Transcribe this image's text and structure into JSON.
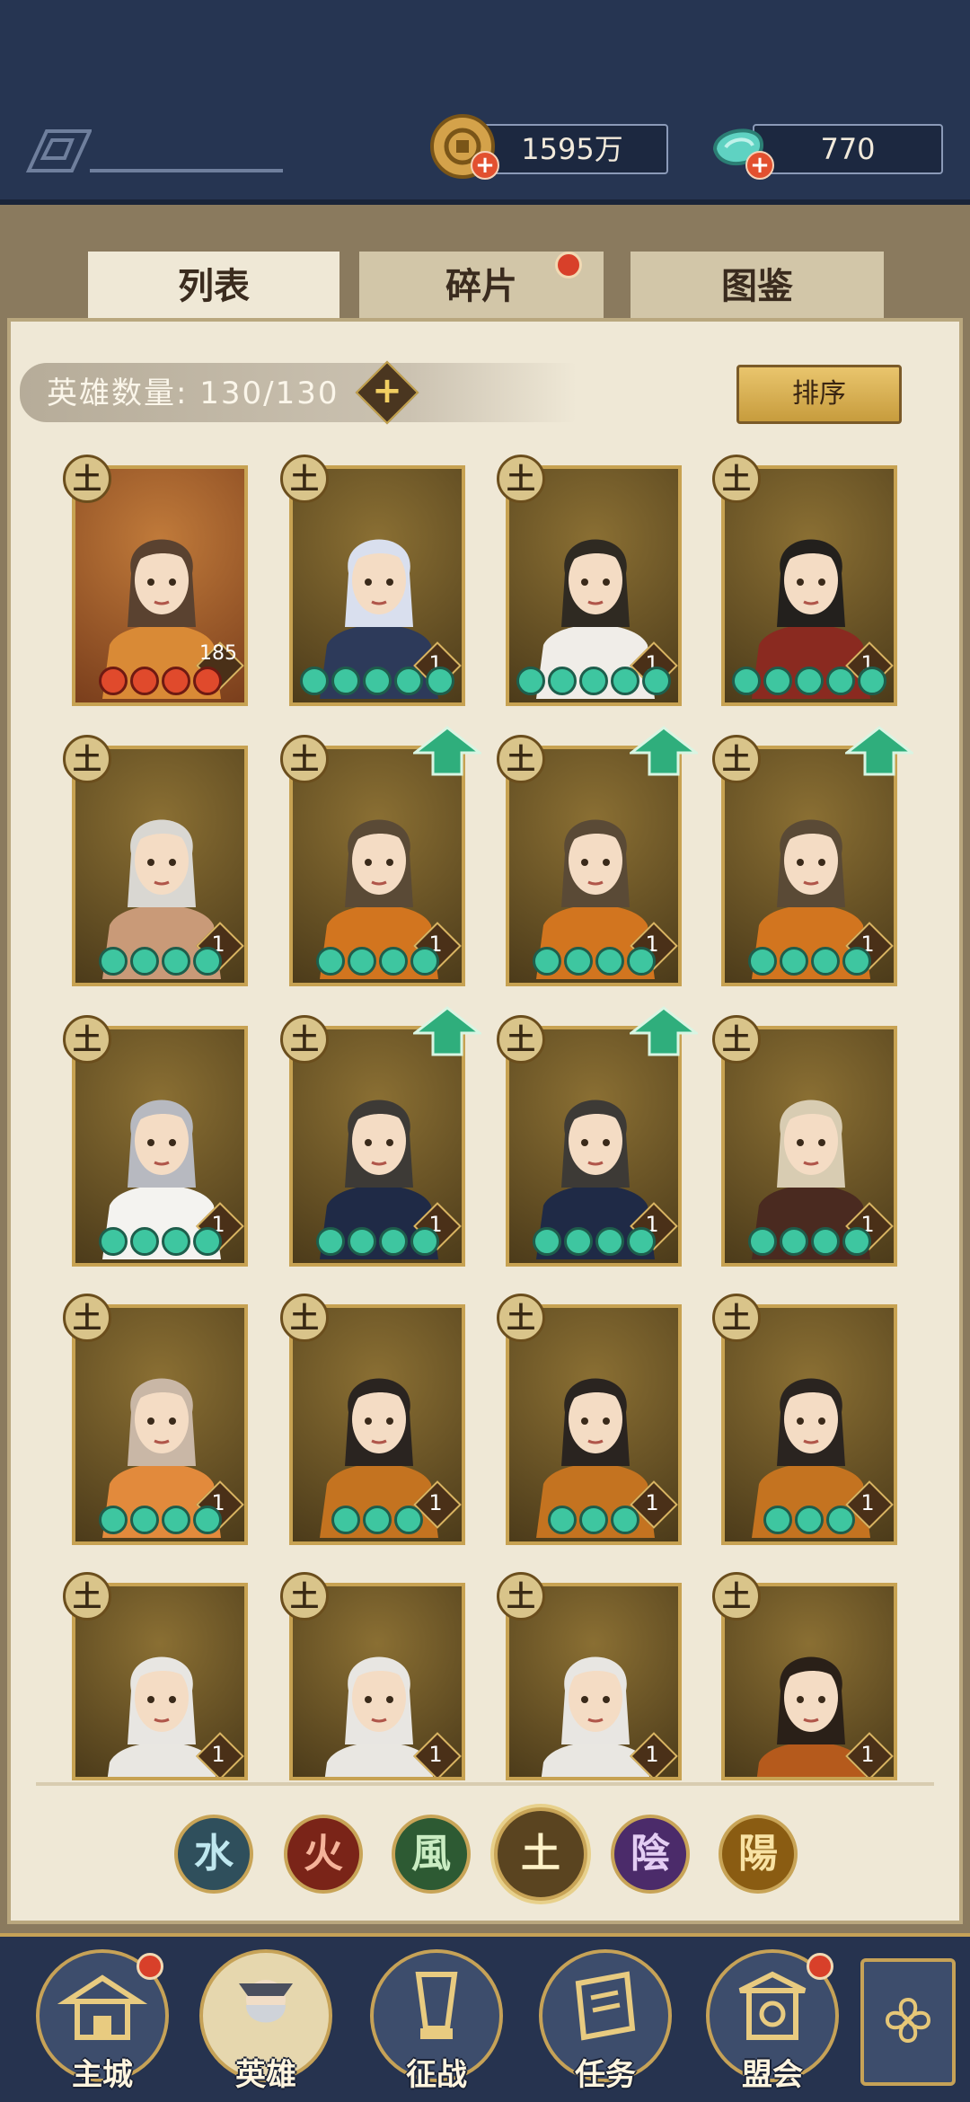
{
  "currency": {
    "coins": "1595万",
    "jade": "770"
  },
  "tabs": [
    {
      "label": "列表",
      "active": true
    },
    {
      "label": "碎片",
      "active": false,
      "badge": true
    },
    {
      "label": "图鉴",
      "active": false
    }
  ],
  "hero_count": "英雄数量: 130/130",
  "sort_label": "排序",
  "element_glyph": "土",
  "heroes": [
    {
      "level": "185",
      "orbs": 4,
      "orb_color": "red",
      "upgrade": false
    },
    {
      "level": "1",
      "orbs": 5,
      "orb_color": "green",
      "upgrade": false
    },
    {
      "level": "1",
      "orbs": 5,
      "orb_color": "green",
      "upgrade": false
    },
    {
      "level": "1",
      "orbs": 5,
      "orb_color": "green",
      "upgrade": false
    },
    {
      "level": "1",
      "orbs": 4,
      "orb_color": "green",
      "upgrade": false
    },
    {
      "level": "1",
      "orbs": 4,
      "orb_color": "green",
      "upgrade": true
    },
    {
      "level": "1",
      "orbs": 4,
      "orb_color": "green",
      "upgrade": true
    },
    {
      "level": "1",
      "orbs": 4,
      "orb_color": "green",
      "upgrade": true
    },
    {
      "level": "1",
      "orbs": 4,
      "orb_color": "green",
      "upgrade": false
    },
    {
      "level": "1",
      "orbs": 4,
      "orb_color": "green",
      "upgrade": true
    },
    {
      "level": "1",
      "orbs": 4,
      "orb_color": "green",
      "upgrade": true
    },
    {
      "level": "1",
      "orbs": 4,
      "orb_color": "green",
      "upgrade": false
    },
    {
      "level": "1",
      "orbs": 4,
      "orb_color": "green",
      "upgrade": false
    },
    {
      "level": "1",
      "orbs": 3,
      "orb_color": "green",
      "upgrade": false
    },
    {
      "level": "1",
      "orbs": 3,
      "orb_color": "green",
      "upgrade": false
    },
    {
      "level": "1",
      "orbs": 3,
      "orb_color": "green",
      "upgrade": false
    },
    {
      "level": "1",
      "orbs": 0,
      "orb_color": "green",
      "upgrade": false
    },
    {
      "level": "1",
      "orbs": 0,
      "orb_color": "green",
      "upgrade": false
    },
    {
      "level": "1",
      "orbs": 0,
      "orb_color": "green",
      "upgrade": false
    },
    {
      "level": "1",
      "orbs": 0,
      "orb_color": "green",
      "upgrade": false
    }
  ],
  "element_filters": [
    {
      "glyph": "水",
      "color": "#2f4f5c",
      "text_color": "#bfe7ef"
    },
    {
      "glyph": "火",
      "color": "#7a2418",
      "text_color": "#f5b39a"
    },
    {
      "glyph": "風",
      "color": "#2d5a33",
      "text_color": "#c9ecc2"
    },
    {
      "glyph": "土",
      "color": "#5a4420",
      "text_color": "#fff2c8",
      "selected": true
    },
    {
      "glyph": "陰",
      "color": "#4b2b6a",
      "text_color": "#e3cdf3"
    },
    {
      "glyph": "陽",
      "color": "#8a5c12",
      "text_color": "#f8e2a3"
    }
  ],
  "nav": [
    {
      "label": "主城",
      "badge": true
    },
    {
      "label": "英雄",
      "badge": false,
      "active": true
    },
    {
      "label": "征战",
      "badge": false
    },
    {
      "label": "任务",
      "badge": false
    },
    {
      "label": "盟会",
      "badge": true
    }
  ],
  "colors": {
    "accent_gold": "#c6a257",
    "navy": "#26334f",
    "parchment": "#efe8d6"
  }
}
